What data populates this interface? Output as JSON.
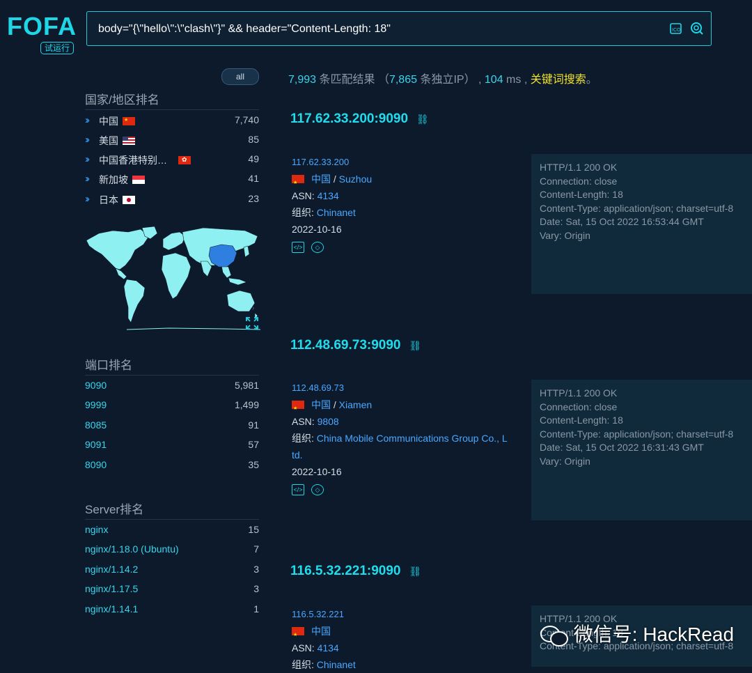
{
  "logo": {
    "text": "FOFA",
    "badge": "试运行"
  },
  "search": {
    "query": "body=\"{\\\"hello\\\":\\\"clash\\\"}\" && header=\"Content-Length: 18\""
  },
  "filter": {
    "all_label": "all"
  },
  "country_section": {
    "title": "国家/地区排名",
    "items": [
      {
        "label": "中国",
        "count": "7,740",
        "flag": "cn-flag"
      },
      {
        "label": "美国",
        "count": "85",
        "flag": "us-flag"
      },
      {
        "label": "中国香港特别…",
        "count": "49",
        "flag": "hk-flag"
      },
      {
        "label": "新加坡",
        "count": "41",
        "flag": "sg-flag"
      },
      {
        "label": "日本",
        "count": "23",
        "flag": "jp-flag"
      }
    ]
  },
  "port_section": {
    "title": "端口排名",
    "items": [
      {
        "label": "9090",
        "count": "5,981"
      },
      {
        "label": "9999",
        "count": "1,499"
      },
      {
        "label": "8085",
        "count": "91"
      },
      {
        "label": "9091",
        "count": "57"
      },
      {
        "label": "8090",
        "count": "35"
      }
    ]
  },
  "server_section": {
    "title": "Server排名",
    "items": [
      {
        "label": "nginx",
        "count": "15"
      },
      {
        "label": "nginx/1.18.0 (Ubuntu)",
        "count": "7"
      },
      {
        "label": "nginx/1.14.2",
        "count": "3"
      },
      {
        "label": "nginx/1.17.5",
        "count": "3"
      },
      {
        "label": "nginx/1.14.1",
        "count": "1"
      }
    ]
  },
  "summary": {
    "total": "7,993",
    "total_suffix": " 条匹配结果 （",
    "unique": "7,865",
    "unique_suffix": " 条独立IP） , ",
    "time": "104",
    "time_suffix": " ms , ",
    "keyword": "关键词搜索",
    "end": "。"
  },
  "results": [
    {
      "host": "117.62.33.200:9090",
      "ip": "117.62.33.200",
      "country": "中国",
      "city": "Suzhou",
      "asn_label": "ASN: ",
      "asn": "4134",
      "org_label": "组织: ",
      "org": "Chinanet",
      "date": "2022-10-16",
      "response": [
        "HTTP/1.1 200 OK",
        "Connection: close",
        "Content-Length: 18",
        "Content-Type: application/json; charset=utf-8",
        "Date: Sat, 15 Oct 2022 16:53:44 GMT",
        "Vary: Origin"
      ]
    },
    {
      "host": "112.48.69.73:9090",
      "ip": "112.48.69.73",
      "country": "中国",
      "city": "Xiamen",
      "asn_label": "ASN: ",
      "asn": "9808",
      "org_label": "组织: ",
      "org": "China Mobile Communications Group Co., L",
      "org2": "td.",
      "date": "2022-10-16",
      "response": [
        "HTTP/1.1 200 OK",
        "Connection: close",
        "Content-Length: 18",
        "Content-Type: application/json; charset=utf-8",
        "Date: Sat, 15 Oct 2022 16:31:43 GMT",
        "Vary: Origin"
      ]
    },
    {
      "host": "116.5.32.221:9090",
      "ip": "116.5.32.221",
      "country": "中国",
      "asn_label": "ASN: ",
      "asn": "4134",
      "org_label": "组织: ",
      "org": "Chinanet",
      "response": [
        "HTTP/1.1 200 OK",
        "",
        "Content-Length: 18",
        "Content-Type: application/json; charset=utf-8"
      ]
    }
  ],
  "watermark": "微信号: HackRead",
  "colors": {
    "accent": "#20dcec",
    "link": "#4aa8ff",
    "keyword": "#f2e22a",
    "background": "#0c1a2c"
  }
}
